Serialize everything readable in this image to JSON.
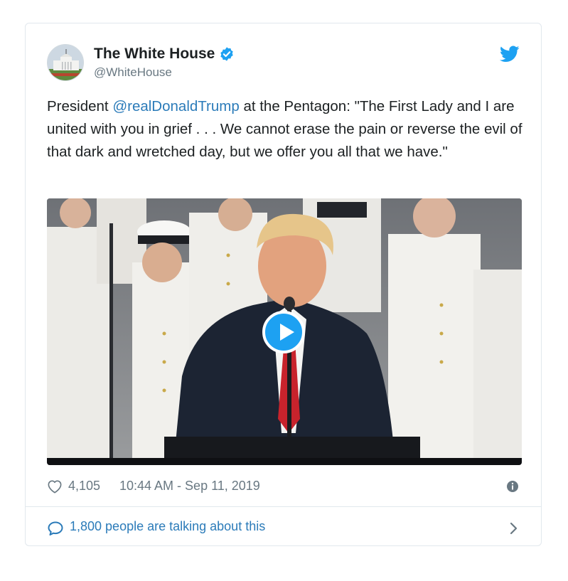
{
  "tweet": {
    "display_name": "The White House",
    "handle": "@WhiteHouse",
    "text_before": "President ",
    "mention": "@realDonaldTrump",
    "text_after": " at the Pentagon: \"The First Lady and I are united with you in grief . . . We cannot erase the pain or reverse the evil of that dark and wretched day, but we offer you all that we have.\"",
    "likes": "4,105",
    "timestamp": "10:44 AM - Sep 11, 2019",
    "talking": "1,800 people are talking about this"
  },
  "icons": {
    "verified": "verified-badge-icon",
    "twitter": "twitter-bird-icon",
    "play": "play-icon",
    "like": "heart-icon",
    "info": "info-icon",
    "reply": "speech-bubble-icon",
    "chevron": "chevron-right-icon"
  },
  "colors": {
    "accent": "#1da1f2",
    "link": "#2b7bb9",
    "text": "#1c2022",
    "muted": "#697882",
    "border": "#e1e8ed"
  }
}
